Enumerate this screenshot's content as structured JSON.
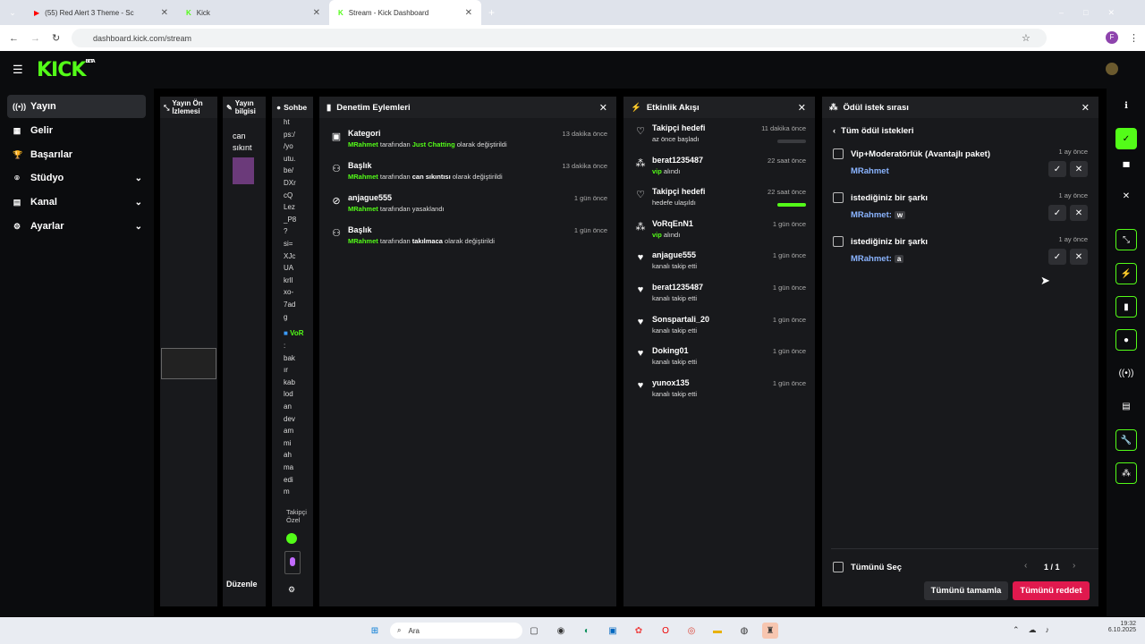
{
  "browser": {
    "tabs": [
      {
        "label": "(55) Red Alert 3 Theme - Sc"
      },
      {
        "label": "Kick"
      },
      {
        "label": "Stream - Kick Dashboard"
      }
    ],
    "url": "dashboard.kick.com/stream"
  },
  "brand": {
    "logo": "KICK",
    "badge": "BETA",
    "accent": "#53fc18"
  },
  "nav": {
    "items": [
      {
        "label": "Yayın"
      },
      {
        "label": "Gelir"
      },
      {
        "label": "Başarılar"
      },
      {
        "label": "Stüdyo"
      },
      {
        "label": "Kanal"
      },
      {
        "label": "Ayarlar"
      }
    ]
  },
  "mini_panels": {
    "preview": "Yayın Ön İzlemesi",
    "info": "Yayın bilgisi",
    "chat": "Sohbe",
    "info_text": "can sıkınt",
    "edit": "Düzenle",
    "chat_lines": [
      "ht",
      "ps:/",
      "/yo",
      "utu.",
      "be/",
      "DXr",
      "cQ",
      "Lez",
      "_P8",
      "?",
      "si=",
      "XJc",
      "UA",
      "krll",
      "xo-",
      "7ad",
      "g"
    ],
    "chat_user": "VoR",
    "chat_lines2": [
      ":",
      "bak",
      "ır",
      "kab",
      "lod",
      "an",
      "dev",
      "am",
      "mi",
      "ah",
      "ma",
      "edi",
      "m"
    ],
    "follower_label": "Takipçi Özel"
  },
  "moderation": {
    "title": "Denetim Eylemleri",
    "rows": [
      {
        "title": "Kategori",
        "user": "MRahmet",
        "mid": "tarafından",
        "value": "Just Chatting",
        "suffix": "olarak değiştirildi",
        "time": "13 dakika önce"
      },
      {
        "title": "Başlık",
        "user": "MRahmet",
        "mid": "tarafından",
        "value": "can sıkıntısı",
        "suffix": "olarak değiştirildi",
        "time": "13 dakika önce"
      },
      {
        "title": "anjague555",
        "user": "MRahmet",
        "mid": "tarafından yasaklandı",
        "value": "",
        "suffix": "",
        "time": "1 gün önce"
      },
      {
        "title": "Başlık",
        "user": "MRahmet",
        "mid": "tarafından",
        "value": "takılmaca",
        "suffix": "olarak değiştirildi",
        "time": "1 gün önce"
      }
    ]
  },
  "activity": {
    "title": "Etkinlik Akışı",
    "rows": [
      {
        "title": "Takipçi hedefi",
        "sub": "az önce başladı",
        "time": "11 dakika önce",
        "progress": 0
      },
      {
        "title": "berat1235487",
        "sub": "vip alındı",
        "time": "22 saat önce"
      },
      {
        "title": "Takipçi hedefi",
        "sub": "hedefe ulaşıldı",
        "time": "22 saat önce",
        "progress": 1
      },
      {
        "title": "VoRqEnN1",
        "sub": "vip alındı",
        "time": "1 gün önce"
      },
      {
        "title": "anjague555",
        "sub": "kanalı takip etti",
        "time": "1 gün önce"
      },
      {
        "title": "berat1235487",
        "sub": "kanalı takip etti",
        "time": "1 gün önce"
      },
      {
        "title": "Sonspartali_20",
        "sub": "kanalı takip etti",
        "time": "1 gün önce"
      },
      {
        "title": "Doking01",
        "sub": "kanalı takip etti",
        "time": "1 gün önce"
      },
      {
        "title": "yunox135",
        "sub": "kanalı takip etti",
        "time": "1 gün önce"
      }
    ]
  },
  "rewards": {
    "title": "Ödül istek sırası",
    "back": "Tüm ödül istekleri",
    "items": [
      {
        "title": "Vip+Moderatörlük (Avantajlı paket)",
        "user": "MRahmet",
        "input": "",
        "time": "1 ay önce"
      },
      {
        "title": "istediğiniz bir şarkı",
        "user": "MRahmet:",
        "input": "w",
        "time": "1 ay önce"
      },
      {
        "title": "istediğiniz bir şarkı",
        "user": "MRahmet:",
        "input": "a",
        "time": "1 ay önce"
      }
    ],
    "select_all": "Tümünü Seç",
    "page": "1 / 1",
    "complete_all": "Tümünü tamamla",
    "reject_all": "Tümünü reddet"
  },
  "taskbar": {
    "search": "Ara",
    "time": "19:32",
    "date": "6.10.2025"
  }
}
